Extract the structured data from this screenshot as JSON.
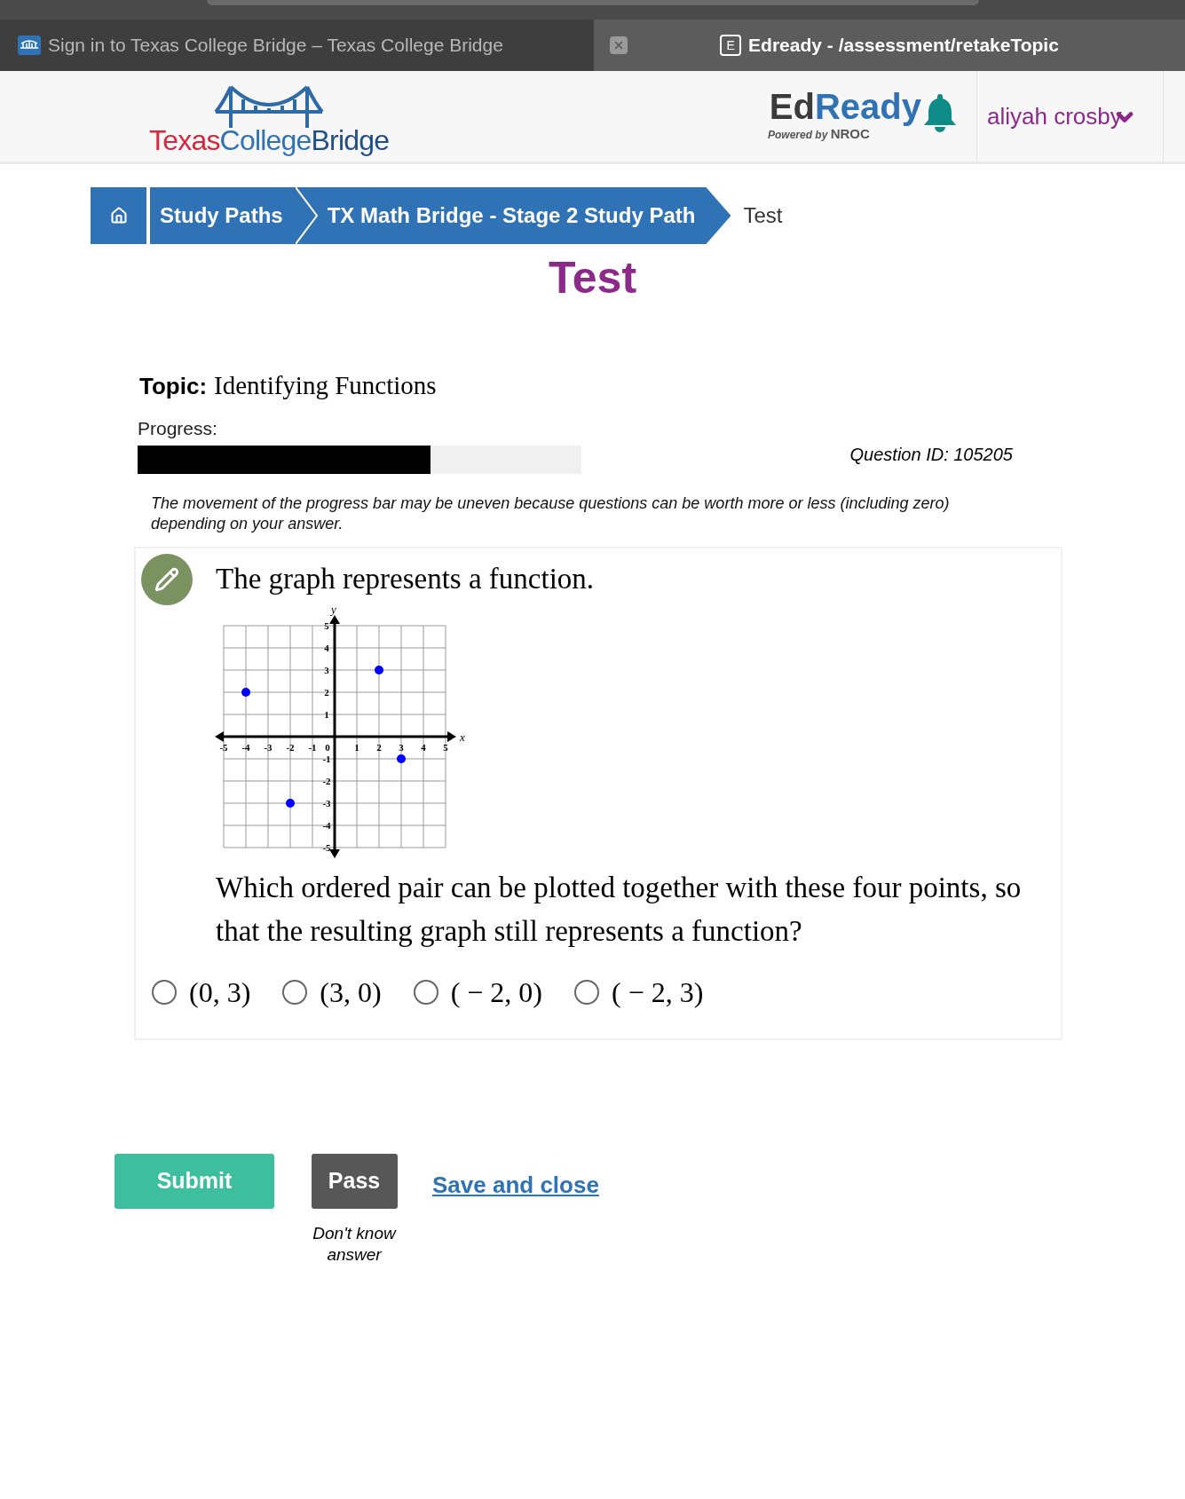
{
  "browser_tabs": [
    {
      "label": "Sign in to Texas College Bridge – Texas College Bridge",
      "selected": false,
      "kind": "site"
    },
    {
      "label": "Edready - /assessment/retakeTopic",
      "selected": true,
      "kind": "letter",
      "icon_letter": "E"
    }
  ],
  "header": {
    "logo_parts": [
      "Texas",
      "College",
      "Bridge"
    ],
    "edready": {
      "ed": "Ed",
      "ready": "Ready",
      "powered_by": "Powered by",
      "nroc": "NROC"
    },
    "user": "aliyah crosby"
  },
  "breadcrumb": [
    {
      "kind": "home"
    },
    {
      "kind": "link",
      "label": "Study Paths"
    },
    {
      "kind": "link",
      "label": "TX Math Bridge - Stage 2 Study Path"
    },
    {
      "kind": "current",
      "label": "Test"
    }
  ],
  "page_title": "Test",
  "topic": {
    "label": "Topic:",
    "value": "Identifying Functions"
  },
  "progress": {
    "label": "Progress:",
    "level": 0.66
  },
  "question_id": "Question ID: 105205",
  "progress_note": "The movement of the progress bar may be uneven because questions can be worth more or less (including zero) depending on your answer.",
  "question": {
    "intro": "The graph represents a function.",
    "chart_data": {
      "type": "scatter",
      "xlabel": "x",
      "ylabel": "y",
      "x": [
        -4,
        2,
        3,
        -2
      ],
      "series": [
        {
          "color": "#0000ff",
          "values": [
            2,
            3,
            -1,
            -3
          ]
        }
      ],
      "grid": true,
      "xlim": [
        -5,
        5
      ],
      "ylim": [
        -5,
        5
      ],
      "xticks": [
        -5,
        -4,
        -3,
        -2,
        -1,
        0,
        1,
        2,
        3,
        4,
        5
      ],
      "yticks": [
        -5,
        -4,
        -3,
        -2,
        -1,
        1,
        2,
        3,
        4,
        5
      ]
    },
    "prompt": "Which ordered pair can be plotted together with these four points, so that the resulting graph still represents a function?",
    "options": [
      {
        "label": "(0, 3)",
        "selected": false
      },
      {
        "label": "(3, 0)",
        "selected": false
      },
      {
        "label": "( − 2, 0)",
        "selected": false
      },
      {
        "label": "( − 2, 3)",
        "selected": false
      }
    ]
  },
  "buttons": {
    "submit": "Submit",
    "pass": "Pass",
    "pass_hint": "Don't know answer",
    "save": "Save and close"
  }
}
